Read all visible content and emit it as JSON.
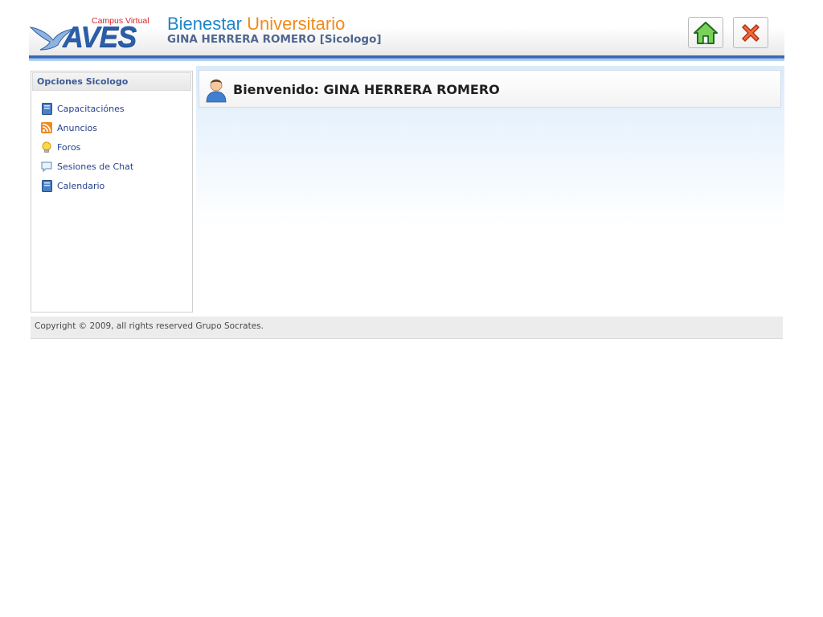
{
  "header": {
    "logo": {
      "campus": "Campus Virtual",
      "name": "AVES"
    },
    "title_part1": "Bienestar",
    "title_part2": "Universitario",
    "user_line": "GINA HERRERA ROMERO [Sicologo]",
    "home_icon": "home-icon",
    "close_icon": "close-icon"
  },
  "sidebar": {
    "heading": "Opciones Sicologo",
    "items": [
      {
        "label": "Capacitaciónes",
        "icon": "book-icon"
      },
      {
        "label": "Anuncios",
        "icon": "rss-icon"
      },
      {
        "label": "Foros",
        "icon": "lightbulb-icon"
      },
      {
        "label": "Sesiones de Chat",
        "icon": "chat-bubble-icon"
      },
      {
        "label": "Calendario",
        "icon": "book-icon"
      }
    ]
  },
  "main": {
    "welcome": "Bienvenido: GINA HERRERA ROMERO",
    "avatar_icon": "user-avatar-icon"
  },
  "footer": {
    "copyright": "Copyright © 2009, all rights reserved Grupo Socrates."
  },
  "colors": {
    "accent_blue": "#3a66b5",
    "title_blue": "#1e86c8",
    "title_orange": "#f08a1c",
    "link": "#27418a"
  }
}
